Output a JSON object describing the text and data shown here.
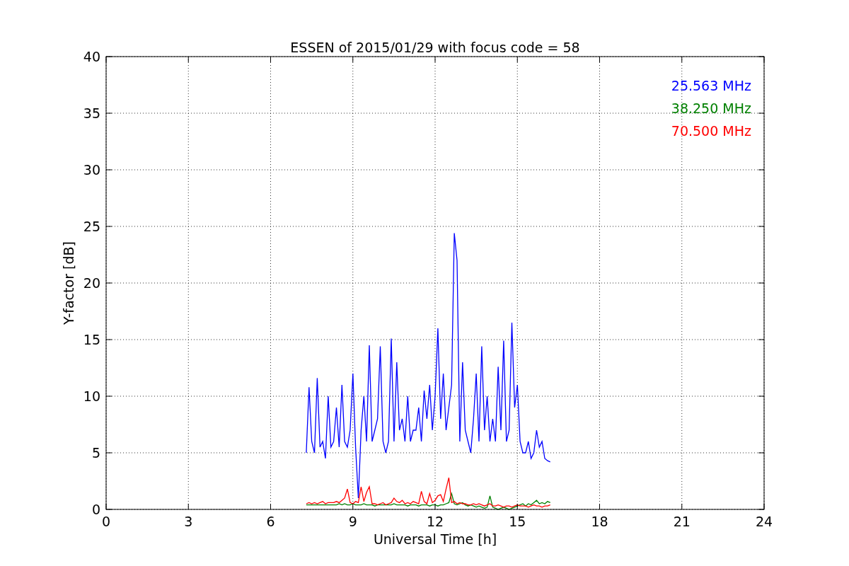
{
  "chart_data": {
    "type": "line",
    "title": "ESSEN of 2015/01/29 with focus code = 58",
    "xlabel": "Universal Time [h]",
    "ylabel": "Y-factor [dB]",
    "x": [
      7.3,
      7.4,
      7.5,
      7.6,
      7.7,
      7.8,
      7.9,
      8.0,
      8.1,
      8.2,
      8.3,
      8.4,
      8.5,
      8.6,
      8.7,
      8.8,
      8.9,
      9.0,
      9.1,
      9.2,
      9.3,
      9.4,
      9.5,
      9.6,
      9.7,
      9.8,
      9.9,
      10.0,
      10.1,
      10.2,
      10.3,
      10.4,
      10.5,
      10.6,
      10.7,
      10.8,
      10.9,
      11.0,
      11.1,
      11.2,
      11.3,
      11.4,
      11.5,
      11.6,
      11.7,
      11.8,
      11.9,
      12.0,
      12.1,
      12.2,
      12.3,
      12.4,
      12.5,
      12.6,
      12.7,
      12.8,
      12.9,
      13.0,
      13.1,
      13.2,
      13.3,
      13.4,
      13.5,
      13.6,
      13.7,
      13.8,
      13.9,
      14.0,
      14.1,
      14.2,
      14.3,
      14.4,
      14.5,
      14.6,
      14.7,
      14.8,
      14.9,
      15.0,
      15.1,
      15.2,
      15.3,
      15.4,
      15.5,
      15.6,
      15.7,
      15.8,
      15.9,
      16.0,
      16.1,
      16.2
    ],
    "series": [
      {
        "name": "25.563 MHz",
        "color": "#0000ff",
        "values": [
          5,
          10.8,
          6,
          5,
          11.6,
          5.5,
          6,
          4.5,
          10,
          5.5,
          6,
          9,
          5.5,
          11,
          6,
          5.5,
          7,
          12,
          5.5,
          1,
          7,
          10,
          6,
          14.5,
          6,
          7,
          8,
          14.4,
          6,
          5,
          6,
          15.1,
          6,
          13,
          7,
          8,
          6,
          10,
          6,
          7,
          7,
          9,
          6,
          10.5,
          8,
          11,
          7,
          10,
          16,
          8,
          12,
          7,
          9,
          11,
          24.4,
          22,
          6,
          13,
          7,
          6,
          5,
          8,
          12,
          6,
          14.4,
          7,
          10,
          6,
          8,
          6,
          12.6,
          7,
          14.9,
          6,
          7,
          16.5,
          9,
          11,
          6,
          5,
          5,
          6,
          4.5,
          5,
          7,
          5.5,
          6,
          4.5,
          4.3,
          4.2
        ]
      },
      {
        "name": "38.250 MHz",
        "color": "#008000",
        "values": [
          0.4,
          0.4,
          0.4,
          0.4,
          0.4,
          0.4,
          0.4,
          0.4,
          0.4,
          0.4,
          0.4,
          0.4,
          0.5,
          0.4,
          0.5,
          0.4,
          0.4,
          0.5,
          0.4,
          0.4,
          0.4,
          0.5,
          0.4,
          0.4,
          0.4,
          0.3,
          0.4,
          0.4,
          0.4,
          0.4,
          0.4,
          0.4,
          0.5,
          0.4,
          0.4,
          0.4,
          0.4,
          0.3,
          0.4,
          0.4,
          0.4,
          0.3,
          0.4,
          0.4,
          0.4,
          0.3,
          0.4,
          0.4,
          0.3,
          0.4,
          0.4,
          0.5,
          0.6,
          1.4,
          0.5,
          0.4,
          0.5,
          0.6,
          0.4,
          0.3,
          0.4,
          0.3,
          0.2,
          0.3,
          0.2,
          0.1,
          0.2,
          1.2,
          0.2,
          0.1,
          0.0,
          0.1,
          0.2,
          0.1,
          0.0,
          0.1,
          0.2,
          0.3,
          0.4,
          0.5,
          0.3,
          0.5,
          0.4,
          0.6,
          0.8,
          0.5,
          0.6,
          0.5,
          0.7,
          0.6
        ]
      },
      {
        "name": "70.500 MHz",
        "color": "#ff0000",
        "values": [
          0.5,
          0.6,
          0.5,
          0.6,
          0.5,
          0.6,
          0.7,
          0.5,
          0.6,
          0.6,
          0.6,
          0.7,
          0.6,
          0.8,
          1.0,
          1.8,
          0.6,
          0.5,
          0.7,
          0.6,
          2.0,
          0.7,
          1.5,
          2.0,
          0.5,
          0.5,
          0.4,
          0.5,
          0.6,
          0.4,
          0.5,
          0.6,
          1.0,
          0.7,
          0.6,
          0.8,
          0.5,
          0.6,
          0.5,
          0.7,
          0.6,
          0.5,
          1.6,
          0.7,
          0.5,
          1.4,
          0.6,
          0.8,
          1.2,
          1.3,
          0.7,
          1.8,
          2.8,
          0.6,
          0.7,
          0.5,
          0.6,
          0.5,
          0.5,
          0.4,
          0.4,
          0.5,
          0.4,
          0.5,
          0.4,
          0.3,
          0.4,
          0.5,
          0.3,
          0.3,
          0.4,
          0.3,
          0.2,
          0.3,
          0.3,
          0.2,
          0.3,
          0.4,
          0.3,
          0.3,
          0.3,
          0.2,
          0.3,
          0.4,
          0.3,
          0.3,
          0.2,
          0.3,
          0.3,
          0.4
        ]
      }
    ],
    "grid": true,
    "xlim": [
      0,
      24
    ],
    "ylim": [
      0,
      40
    ],
    "xticks": [
      0,
      3,
      6,
      9,
      12,
      15,
      18,
      21,
      24
    ],
    "yticks": [
      0,
      5,
      10,
      15,
      20,
      25,
      30,
      35,
      40
    ]
  }
}
